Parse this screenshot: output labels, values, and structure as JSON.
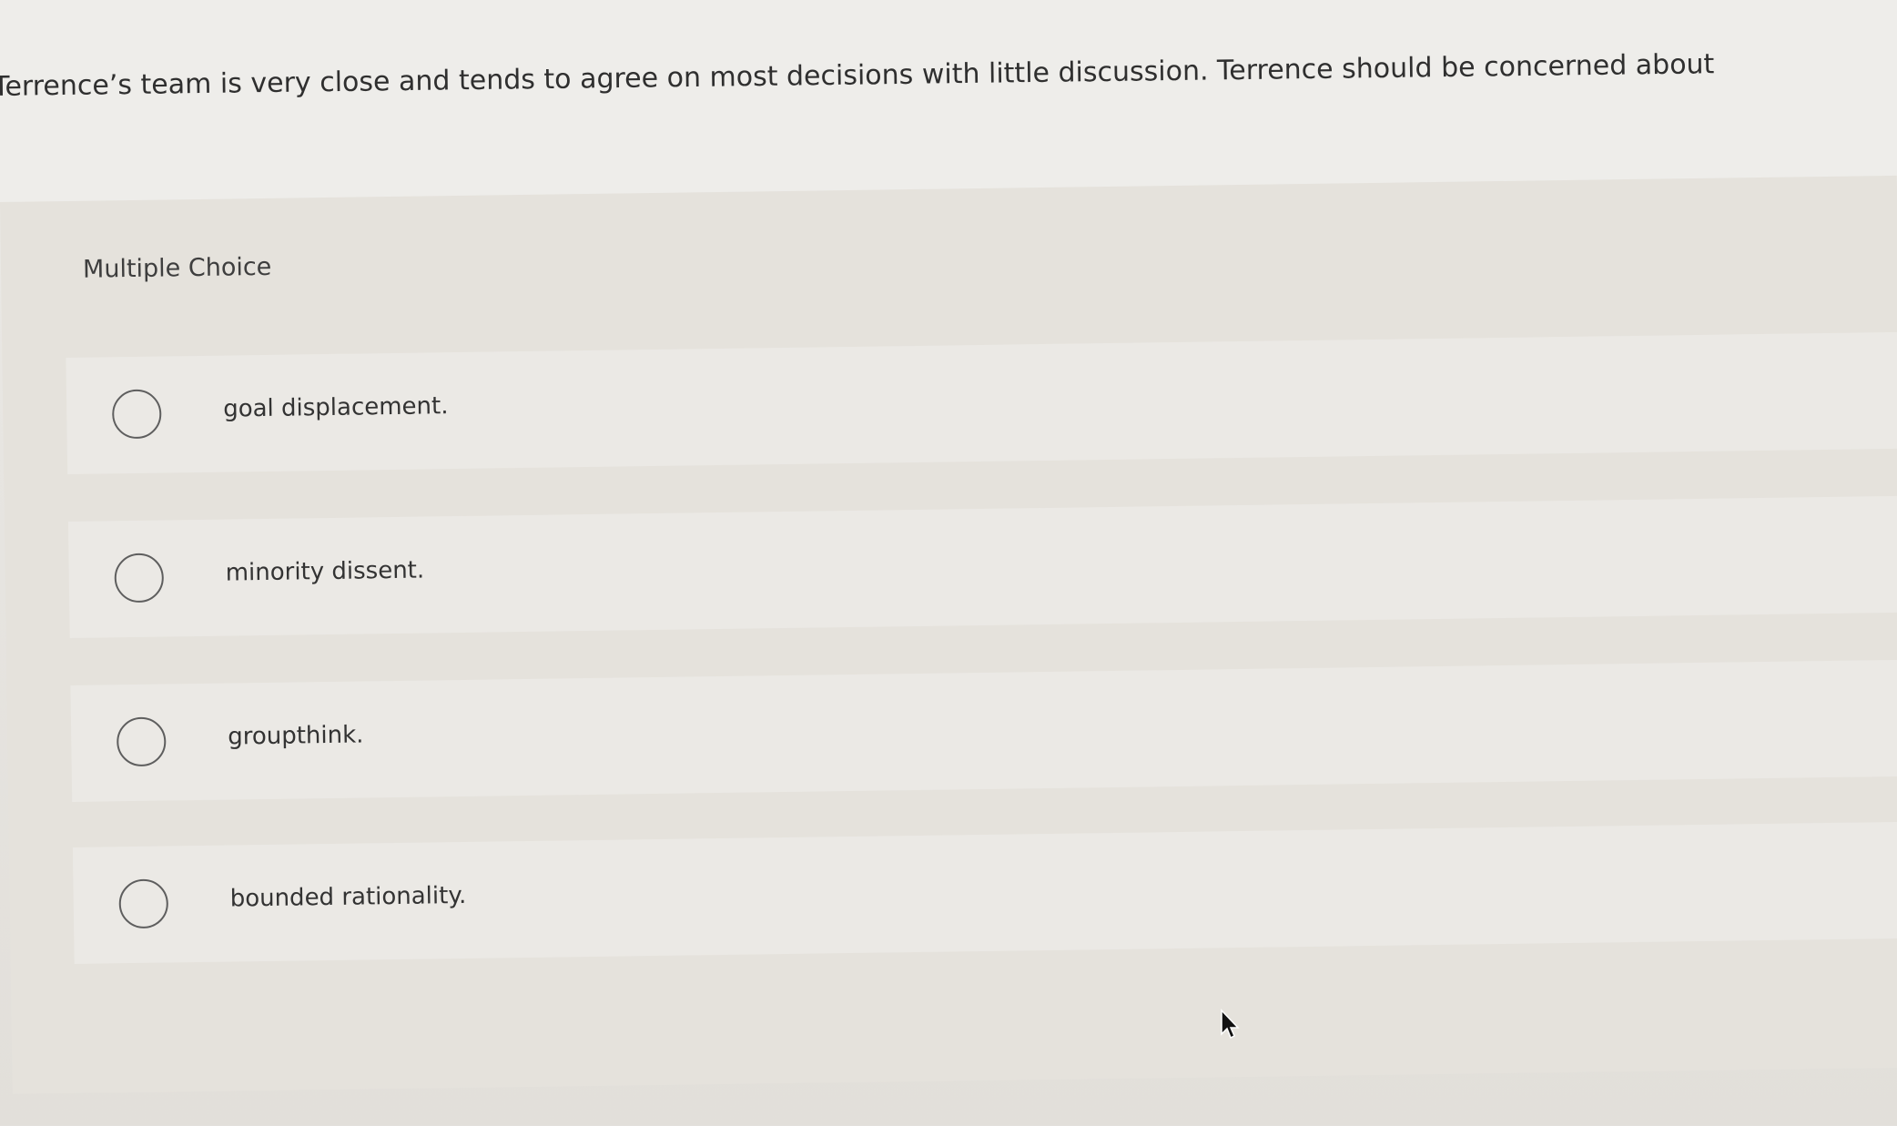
{
  "question": {
    "text": "Terrence’s team is very close and tends to agree on most decisions with little discussion. Terrence should be concerned about"
  },
  "answer_panel": {
    "heading": "Multiple Choice",
    "options": [
      {
        "label": "goal displacement.",
        "selected": false
      },
      {
        "label": "minority dissent.",
        "selected": false
      },
      {
        "label": "groupthink.",
        "selected": false
      },
      {
        "label": "bounded rationality.",
        "selected": false
      }
    ]
  },
  "icons": {
    "radio": "radio-unselected-icon",
    "cursor": "mouse-pointer-icon"
  }
}
